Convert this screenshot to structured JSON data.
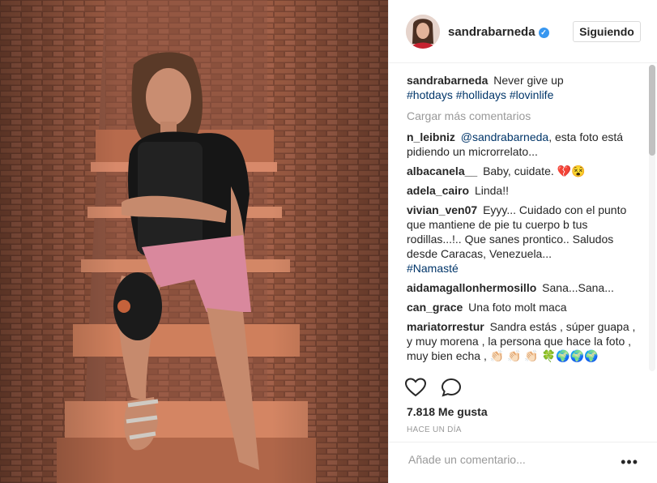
{
  "post": {
    "username": "sandrabarneda",
    "follow_label": "Siguiendo",
    "caption": {
      "user": "sandrabarneda",
      "text": "Never give up"
    },
    "caption_tags": [
      "#hotdays",
      "#hollidays",
      "#lovinlife"
    ],
    "load_more": "Cargar más comentarios",
    "comments": [
      {
        "user": "n_leibniz",
        "mention": "@sandrabarneda",
        "text": ", esta foto está pidiendo un microrrelato..."
      },
      {
        "user": "albacanela__",
        "text": "Baby, cuidate. 💔😵"
      },
      {
        "user": "adela_cairo",
        "text": "Linda!!"
      },
      {
        "user": "vivian_ven07",
        "text": "Eyyy... Cuidado con el punto que mantiene de pie tu cuerpo b tus rodillas...!.. Que sanes prontico.. Saludos desde Caracas, Venezuela...",
        "tag": "#Namasté"
      },
      {
        "user": "aidamagallonhermosillo",
        "text": "Sana...Sana..."
      },
      {
        "user": "can_grace",
        "text": "Una foto molt maca"
      },
      {
        "user": "mariatorrestur",
        "text": "Sandra estás , súper guapa , y muy morena , la persona que hace la foto , muy bien echa , 👏🏻 👏🏻 👏🏻 🍀🌍🌍🌍"
      }
    ],
    "likes": "7.818 Me gusta",
    "time": "HACE UN DÍA",
    "add_comment_placeholder": "Añade un comentario...",
    "more_label": "•••"
  },
  "icons": {
    "verified": "verified-badge-icon",
    "like": "heart-icon",
    "comment": "comment-icon",
    "more": "more-options-icon"
  },
  "colors": {
    "link": "#003569",
    "verified": "#3897f0",
    "muted": "#999999",
    "border": "#efefef"
  }
}
